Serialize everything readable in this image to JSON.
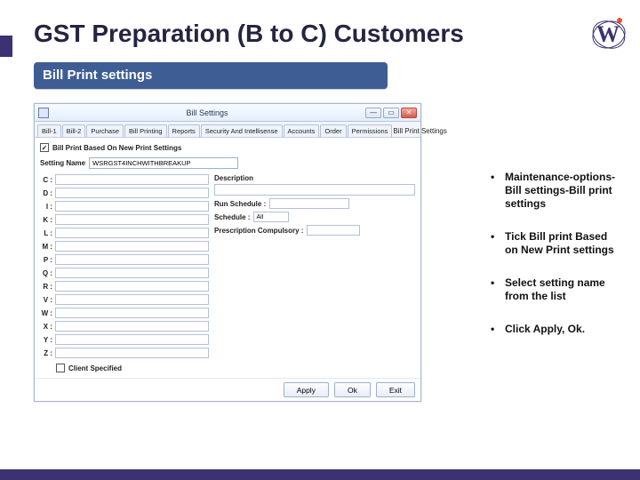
{
  "slide": {
    "title": "GST Preparation (B to C) Customers",
    "ribbon": "Bill Print settings",
    "logo_letter": "W"
  },
  "bullets": [
    "Maintenance-options-Bill settings-Bill print settings",
    "Tick Bill print Based on New Print settings",
    "Select  setting name from the list",
    "Click Apply, Ok."
  ],
  "app": {
    "title": "Bill Settings",
    "winbtn_min": "—",
    "winbtn_max": "▭",
    "winbtn_close": "✕",
    "tabs": [
      "Bill-1",
      "Bill-2",
      "Purchase",
      "Bill Printing",
      "Reports",
      "Security And Intellisense",
      "Accounts",
      "Order",
      "Permissions"
    ],
    "extra_tab": "Bill Print Settings",
    "checkbox": {
      "checked": "✓",
      "label": "Bill Print Based On New Print Settings"
    },
    "setting_label": "Setting Name",
    "setting_value": "WSRGST4INCHWITHBREAKUP",
    "field_labels": [
      "C :",
      "D :",
      "I :",
      "K :",
      "L :",
      "M :",
      "P :",
      "Q :",
      "R :",
      "V :",
      "W :",
      "X :",
      "Y :",
      "Z :"
    ],
    "description_label": "Description",
    "run_schedule": {
      "label": "Run Schedule :",
      "value": ""
    },
    "schedule": {
      "label": "Schedule :",
      "value": "All"
    },
    "rx": {
      "label": "Prescription Compulsory :",
      "value": ""
    },
    "client_label": "Client Specified",
    "buttons": {
      "apply": "Apply",
      "ok": "Ok",
      "exit": "Exit"
    }
  }
}
